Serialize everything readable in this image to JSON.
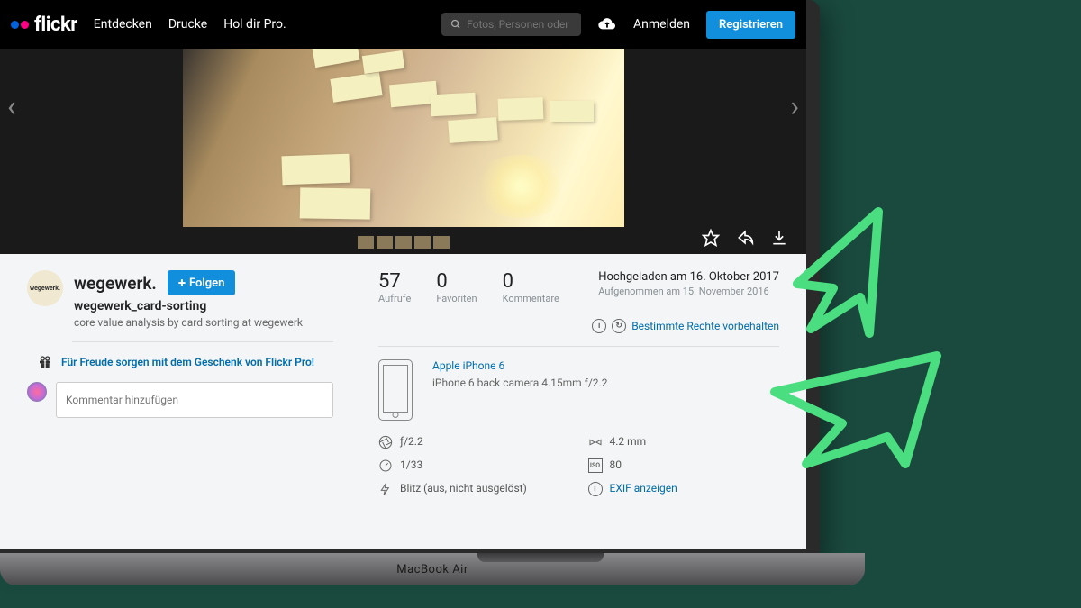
{
  "brand": "flickr",
  "nav": {
    "explore": "Entdecken",
    "prints": "Drucke",
    "getpro": "Hol dir Pro."
  },
  "search": {
    "placeholder": "Fotos, Personen oder Grupp"
  },
  "auth": {
    "login": "Anmelden",
    "register": "Registrieren"
  },
  "author": {
    "name": "wegewerk.",
    "avatar_text": "wegewerk.",
    "follow": "Folgen"
  },
  "photo": {
    "title": "wegewerk_card-sorting",
    "description": "core value analysis by card sorting at wegewerk"
  },
  "gift": {
    "text": "Für Freude sorgen mit dem Geschenk von Flickr Pro!"
  },
  "comment": {
    "placeholder": "Kommentar hinzufügen"
  },
  "stats": {
    "views": {
      "value": "57",
      "label": "Aufrufe"
    },
    "faves": {
      "value": "0",
      "label": "Favoriten"
    },
    "comments": {
      "value": "0",
      "label": "Kommentare"
    }
  },
  "upload": {
    "uploaded": "Hochgeladen am 16. Oktober 2017",
    "taken": "Aufgenommen am 15. November 2016"
  },
  "license": {
    "text": "Bestimmte Rechte vorbehalten"
  },
  "camera": {
    "model": "Apple iPhone 6",
    "lens": "iPhone 6 back camera 4.15mm f/2.2"
  },
  "exif": {
    "aperture": "ƒ/2.2",
    "focal": "4.2 mm",
    "shutter": "1/33",
    "iso": "80",
    "flash": "Blitz (aus, nicht ausgelöst)",
    "show": "EXIF anzeigen",
    "iso_label": "ISO"
  },
  "laptop": "MacBook Air"
}
